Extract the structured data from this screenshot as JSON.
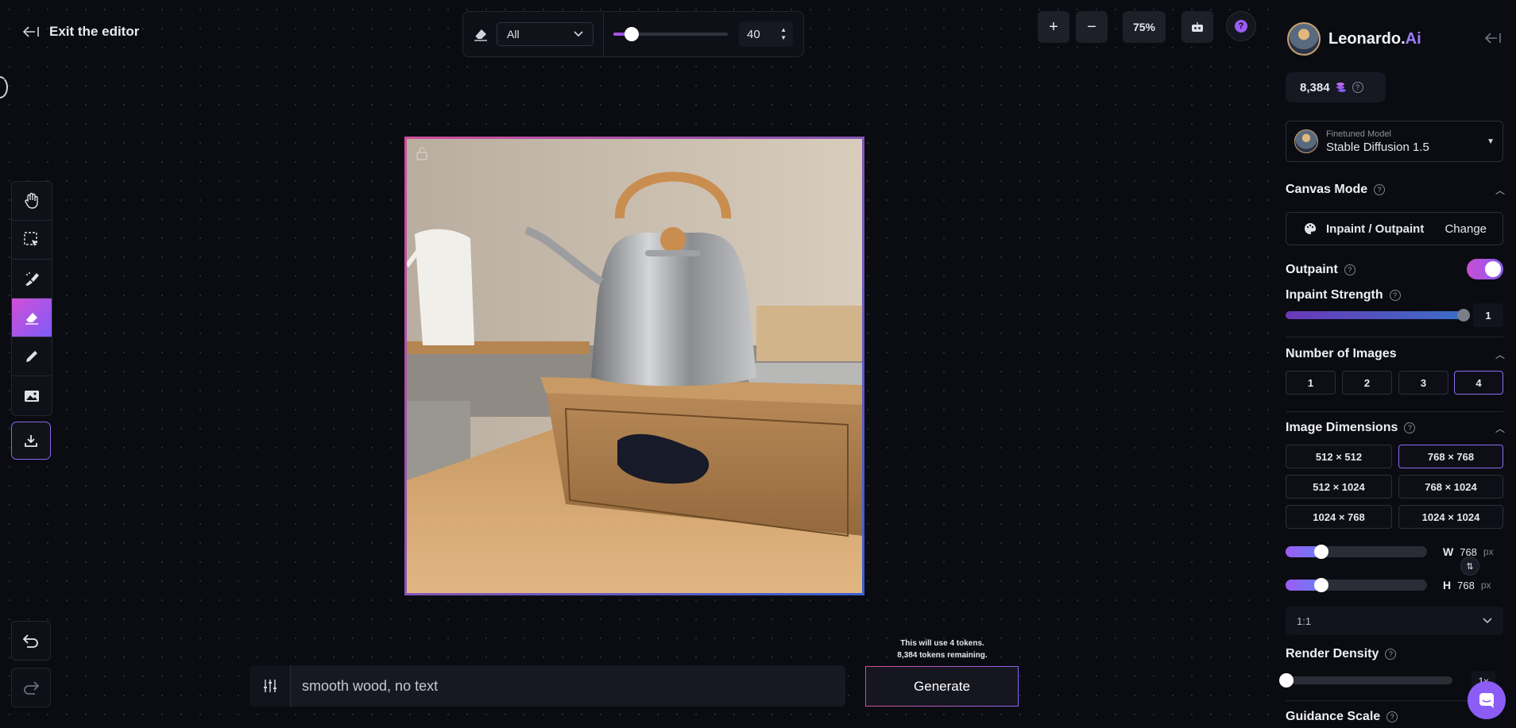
{
  "header": {
    "exit_label": "Exit the editor"
  },
  "toolbar": {
    "eraser_mode": "All",
    "brush_size": "40",
    "brush_size_value": 40,
    "zoom_in": "+",
    "zoom_out": "−",
    "zoom_level": "75%"
  },
  "tools": [
    "hand-icon",
    "select-icon",
    "inpaint-brush-icon",
    "eraser-icon",
    "pencil-icon",
    "image-icon",
    "download-icon",
    "undo-icon",
    "redo-icon"
  ],
  "prompt": {
    "text": "smooth wood, no text",
    "token_line1": "This will use 4 tokens.",
    "token_line2": "8,384 tokens remaining.",
    "generate_label": "Generate"
  },
  "panel": {
    "brand_name": "Leonardo.",
    "brand_ai": "Ai",
    "tokens": "8,384",
    "model_small": "Finetuned Model",
    "model_name": "Stable Diffusion 1.5",
    "canvas_mode_title": "Canvas Mode",
    "canvas_mode": "Inpaint / Outpaint",
    "change_label": "Change",
    "outpaint_title": "Outpaint",
    "outpaint_on": true,
    "inpaint_strength_title": "Inpaint Strength",
    "inpaint_strength": "1",
    "num_images_title": "Number of Images",
    "num_images": [
      "1",
      "2",
      "3",
      "4"
    ],
    "num_images_selected": "4",
    "dimensions_title": "Image Dimensions",
    "dimensions": [
      "512 × 512",
      "768 × 768",
      "512 × 1024",
      "768 × 1024",
      "1024 × 768",
      "1024 × 1024"
    ],
    "dimensions_selected": "768 × 768",
    "width_letter": "W",
    "width": "768",
    "height_letter": "H",
    "height": "768",
    "px": "px",
    "aspect_ratio": "1:1",
    "render_density_title": "Render Density",
    "render_density": "1x",
    "guidance_scale_title": "Guidance Scale"
  },
  "colors": {
    "accent_pink": "#d14fd8",
    "accent_purple": "#8b5cf6",
    "background": "#0b0c12"
  }
}
